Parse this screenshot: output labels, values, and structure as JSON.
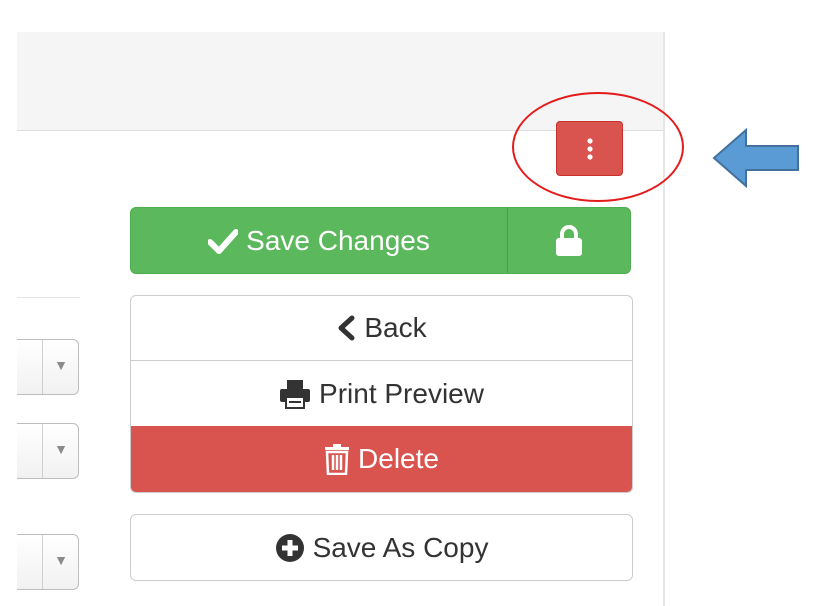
{
  "toolbar": {
    "more_icon": "vertical-ellipsis-icon",
    "more_color": "#d9534f"
  },
  "actions": {
    "save_changes_label": "Save Changes",
    "lock_icon": "lock-icon",
    "back_label": "Back",
    "print_preview_label": "Print Preview",
    "delete_label": "Delete",
    "save_as_copy_label": "Save As Copy"
  },
  "colors": {
    "success": "#5cb85c",
    "danger": "#d9534f",
    "annotation_circle": "#e31b1b",
    "annotation_arrow": "#5b9bd5"
  }
}
